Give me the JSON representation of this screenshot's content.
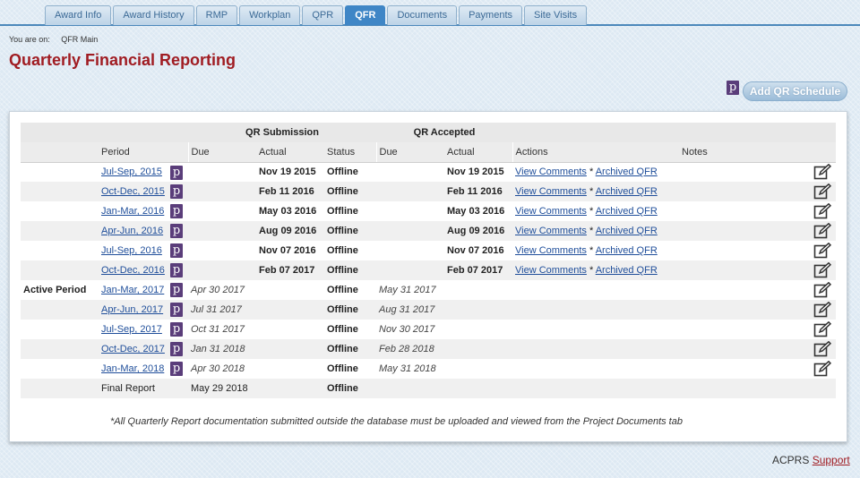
{
  "tabs": [
    "Award Info",
    "Award History",
    "RMP",
    "Workplan",
    "QPR",
    "QFR",
    "Documents",
    "Payments",
    "Site Visits"
  ],
  "active_tab": "QFR",
  "breadcrumb": {
    "prefix": "You are on:",
    "location": "QFR Main"
  },
  "page_title": "Quarterly Financial Reporting",
  "add_button": "Add QR Schedule",
  "p_icon_glyph": "p",
  "table": {
    "group_headers": {
      "submission": "QR Submission",
      "accepted": "QR Accepted"
    },
    "columns": {
      "period": "Period",
      "due": "Due",
      "actual": "Actual",
      "status": "Status",
      "acc_due": "Due",
      "acc_actual": "Actual",
      "actions": "Actions",
      "notes": "Notes"
    },
    "rows": [
      {
        "label": "",
        "period": "Jul-Sep, 2015",
        "due": "",
        "actual": "Nov 19 2015",
        "status": "Offline",
        "acc_due": "",
        "acc_actual": "Nov 19 2015",
        "comments": "View Comments",
        "sep": " * ",
        "archived": "Archived QFR"
      },
      {
        "label": "",
        "period": "Oct-Dec, 2015",
        "due": "",
        "actual": "Feb 11 2016",
        "status": "Offline",
        "acc_due": "",
        "acc_actual": "Feb 11 2016",
        "comments": "View Comments",
        "sep": " * ",
        "archived": "Archived QFR"
      },
      {
        "label": "",
        "period": "Jan-Mar, 2016",
        "due": "",
        "actual": "May 03 2016",
        "status": "Offline",
        "acc_due": "",
        "acc_actual": "May 03 2016",
        "comments": "View Comments",
        "sep": " * ",
        "archived": "Archived QFR"
      },
      {
        "label": "",
        "period": "Apr-Jun, 2016",
        "due": "",
        "actual": "Aug 09 2016",
        "status": "Offline",
        "acc_due": "",
        "acc_actual": "Aug 09 2016",
        "comments": "View Comments",
        "sep": " * ",
        "archived": "Archived QFR"
      },
      {
        "label": "",
        "period": "Jul-Sep, 2016",
        "due": "",
        "actual": "Nov 07 2016",
        "status": "Offline",
        "acc_due": "",
        "acc_actual": "Nov 07 2016",
        "comments": "View Comments",
        "sep": " * ",
        "archived": "Archived QFR"
      },
      {
        "label": "",
        "period": "Oct-Dec, 2016",
        "due": "",
        "actual": "Feb 07 2017",
        "status": "Offline",
        "acc_due": "",
        "acc_actual": "Feb 07 2017",
        "comments": "View Comments",
        "sep": " * ",
        "archived": "Archived QFR"
      },
      {
        "label": "Active Period",
        "period": "Jan-Mar, 2017",
        "due": "Apr 30 2017",
        "actual": "",
        "status": "Offline",
        "acc_due": "May 31 2017",
        "acc_actual": "",
        "comments": "",
        "sep": "",
        "archived": ""
      },
      {
        "label": "",
        "period": "Apr-Jun, 2017",
        "due": "Jul 31 2017",
        "actual": "",
        "status": "Offline",
        "acc_due": "Aug 31 2017",
        "acc_actual": "",
        "comments": "",
        "sep": "",
        "archived": ""
      },
      {
        "label": "",
        "period": "Jul-Sep, 2017",
        "due": "Oct 31 2017",
        "actual": "",
        "status": "Offline",
        "acc_due": "Nov 30 2017",
        "acc_actual": "",
        "comments": "",
        "sep": "",
        "archived": ""
      },
      {
        "label": "",
        "period": "Oct-Dec, 2017",
        "due": "Jan 31 2018",
        "actual": "",
        "status": "Offline",
        "acc_due": "Feb 28 2018",
        "acc_actual": "",
        "comments": "",
        "sep": "",
        "archived": ""
      },
      {
        "label": "",
        "period": "Jan-Mar, 2018",
        "due": "Apr 30 2018",
        "actual": "",
        "status": "Offline",
        "acc_due": "May 31 2018",
        "acc_actual": "",
        "comments": "",
        "sep": "",
        "archived": ""
      }
    ],
    "final_row": {
      "period": "Final Report",
      "due": "May 29 2018",
      "status": "Offline"
    }
  },
  "footnote": "*All Quarterly Report documentation submitted outside the database must be uploaded and viewed from the Project Documents tab",
  "footer": {
    "app": "ACPRS",
    "support": "Support"
  }
}
